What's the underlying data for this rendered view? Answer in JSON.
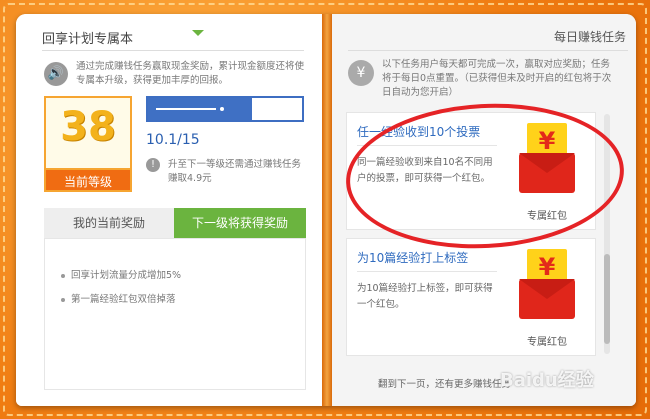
{
  "left": {
    "title": "回享计划专属本",
    "intro": "通过完成赚钱任务赢取现金奖励，累计现金额度还将使专属本升级，获得更加丰厚的回报。",
    "level": {
      "number": "38",
      "label": "当前等级"
    },
    "progress": {
      "text": "10.1/15",
      "fraction": 0.673
    },
    "upgrade_tip": "升至下一等级还需通过赚钱任务赚取4.9元",
    "tabs": {
      "current": "我的当前奖励",
      "next": "下一级将获得奖励"
    },
    "rewards": [
      "回享计划流量分成增加5%",
      "第一篇经验红包双倍掉落"
    ]
  },
  "right": {
    "title": "每日赚钱任务",
    "intro": "以下任务用户每天都可完成一次，赢取对应奖励；任务将于每日0点重置。（已获得但未及时开启的红包将于次日自动为您开启）",
    "tasks": [
      {
        "title": "任一经验收到10个投票",
        "desc": "同一篇经验收到来自10名不同用户的投票，即可获得一个红包。",
        "reward_label": "专属红包"
      },
      {
        "title": "为10篇经验打上标签",
        "desc": "为10篇经验打上标签，即可获得一个红包。",
        "reward_label": "专属红包"
      }
    ],
    "bottom_tip": "翻到下一页，还有更多赚钱任务"
  },
  "watermark": "Baidu经验",
  "colors": {
    "accent_orange": "#f06c12",
    "accent_green": "#6bb43f",
    "accent_blue": "#3f70c4",
    "circle_red": "#e52326"
  },
  "icons": {
    "speaker": "speaker-icon",
    "info": "info-icon",
    "yen": "yen-icon",
    "envelope": "red-envelope-icon"
  }
}
